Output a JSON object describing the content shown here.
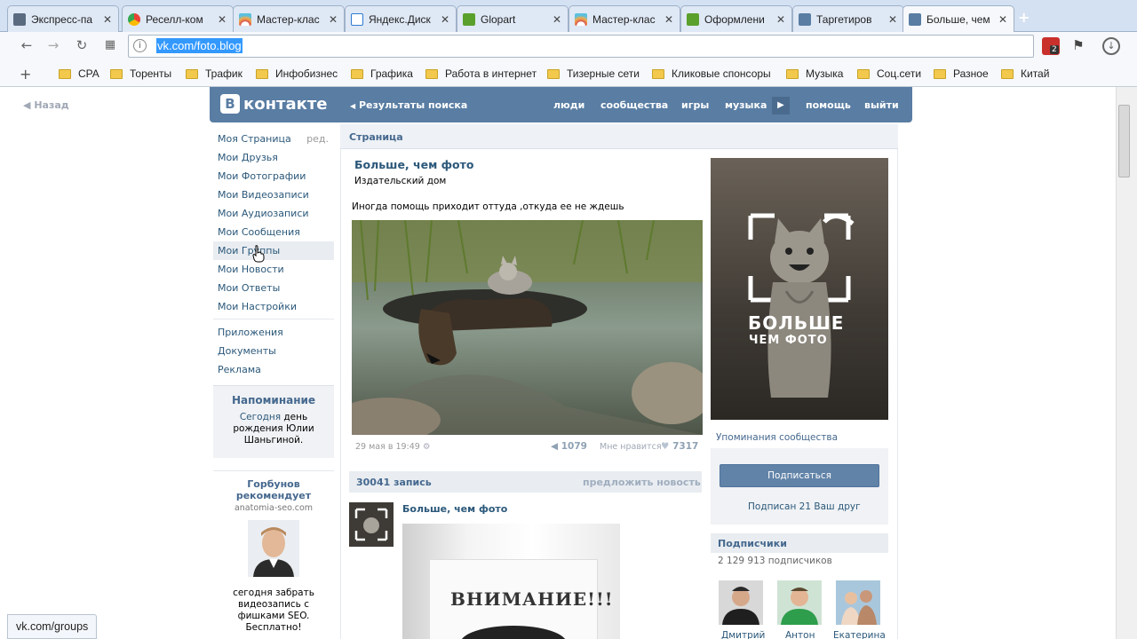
{
  "browser": {
    "tabs": [
      {
        "label": "Экспресс-па",
        "icon_color": "#5a6b80"
      },
      {
        "label": "Реселл-ком",
        "icon_color": "#4285f4"
      },
      {
        "label": "Мастер-клас",
        "icon_color": "#d9534f"
      },
      {
        "label": "Яндекс.Диск",
        "icon_color": "#2f7bd0"
      },
      {
        "label": "Glopart",
        "icon_color": "#5aa02c"
      },
      {
        "label": "Мастер-клас",
        "icon_color": "#d9534f"
      },
      {
        "label": "Оформлени",
        "icon_color": "#5aa02c"
      },
      {
        "label": "Таргетиров",
        "icon_color": "#597da3"
      },
      {
        "label": "Больше, чем",
        "icon_color": "#597da3"
      }
    ],
    "url": "vk.com/foto.blog",
    "bookmarks": [
      "CPA",
      "Торенты",
      "Трафик",
      "Инфобизнес",
      "Графика",
      "Работа в интернет",
      "Тизерные сети",
      "Кликовые спонсоры",
      "Музыка",
      "Соц.сети",
      "Разное",
      "Китай"
    ],
    "extension_badge": "2",
    "status_url": "vk.com/groups"
  },
  "vk": {
    "logo": "контакте",
    "back": "Назад",
    "search_results": "Результаты поиска",
    "nav": [
      "люди",
      "сообщества",
      "игры",
      "музыка",
      "помощь",
      "выйти"
    ],
    "menu": [
      "Моя Страница",
      "Мои Друзья",
      "Мои Фотографии",
      "Мои Видеозаписи",
      "Мои Аудиозаписи",
      "Мои Сообщения",
      "Мои Группы",
      "Мои Новости",
      "Мои Ответы",
      "Мои Настройки"
    ],
    "menu_edit": "ред.",
    "menu_extra": [
      "Приложения",
      "Документы",
      "Реклама"
    ],
    "reminder": {
      "title": "Напоминание",
      "text_before": "Сегодня",
      "text_link": "день рождения Юлии Шаньгиной",
      "text_after": "."
    },
    "promo": {
      "title": "Горбунов рекомендует",
      "site": "anatomia-seo.com",
      "text": "сегодня забрать видеозапись с фишками SEO. Бесплатно!"
    },
    "page_header": "Страница",
    "group": {
      "name": "Больше, чем фото",
      "subtitle": "Издательский дом",
      "status": "Иногда помощь приходит оттуда ,откуда ее не ждешь",
      "date": "29 мая в 19:49",
      "shares": "1079",
      "like_label": "Мне нравится",
      "likes": "7317",
      "cover_line1": "БОЛЬШЕ",
      "cover_line2": "ЧЕМ ФОТО",
      "mentions": "Упоминания сообщества",
      "subscribe": "Подписаться",
      "subscribed_friends": "Подписан 21 Ваш друг",
      "subscribers_title": "Подписчики",
      "subscribers_count": "2 129 913 подписчиков",
      "subscribers": [
        "Дмитрий",
        "Антон",
        "Екатерина"
      ]
    },
    "wall": {
      "count": "30041 запись",
      "suggest": "предложить новость",
      "post_author": "Больше, чем фото",
      "post_image_text": "ВНИМАНИЕ!!!"
    }
  }
}
